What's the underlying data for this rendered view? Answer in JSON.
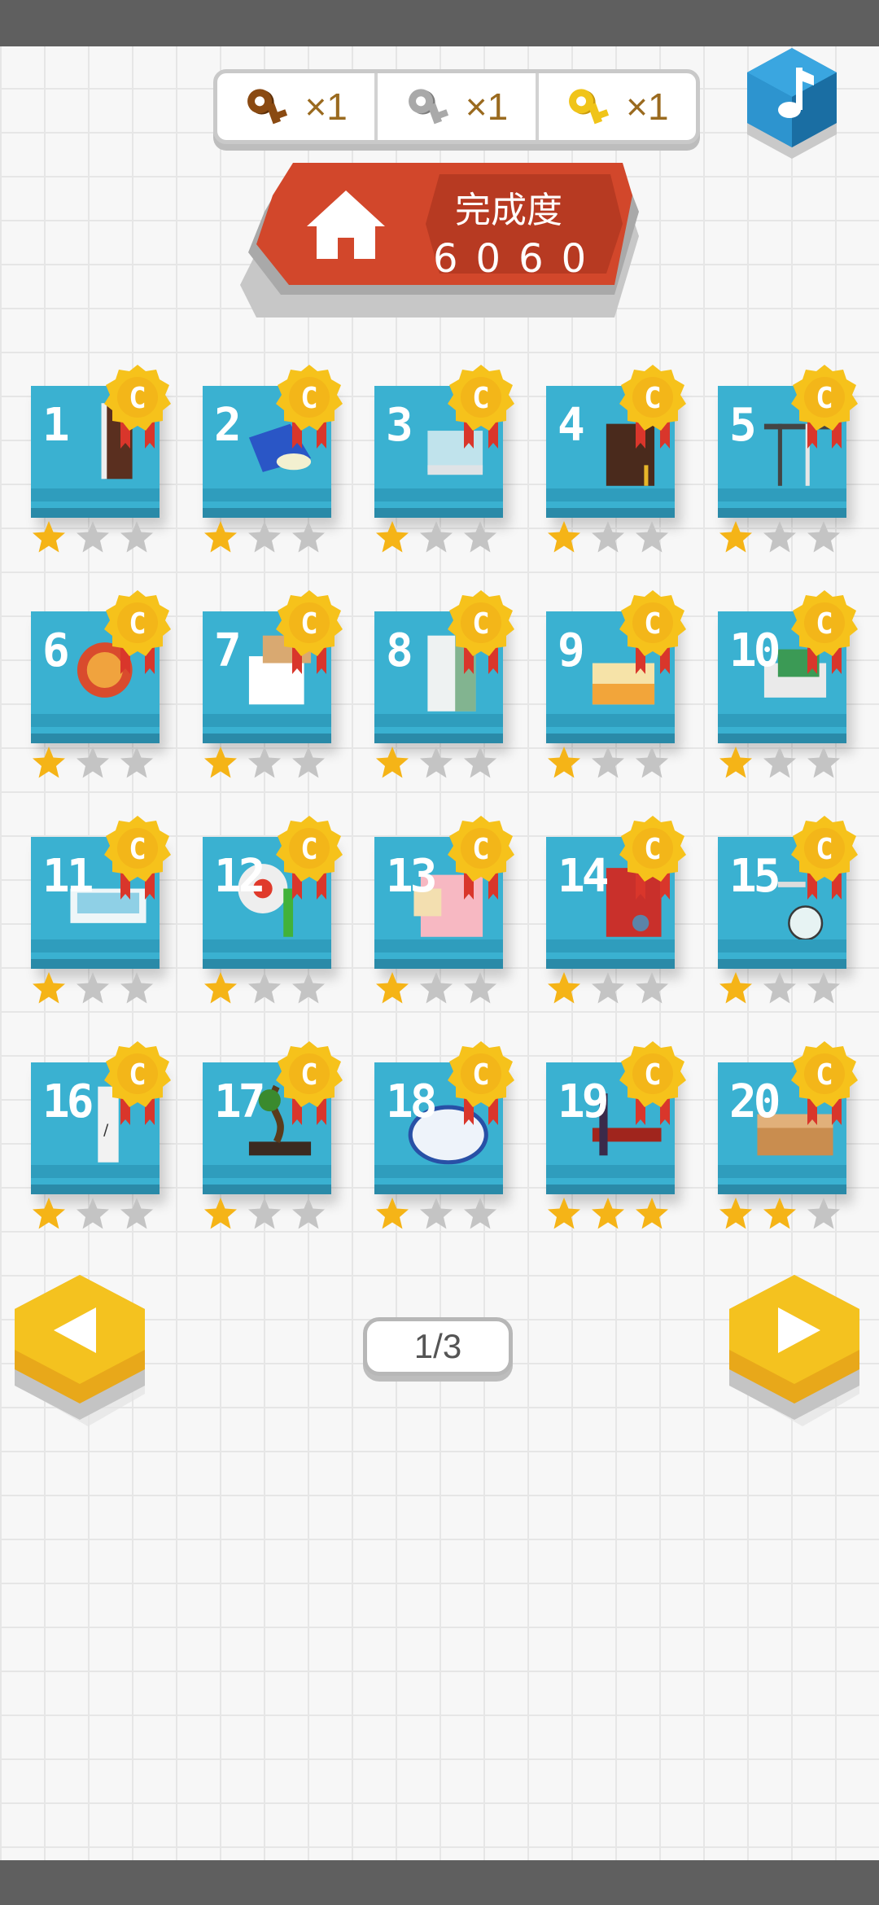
{
  "keys": [
    {
      "name": "bronze-key",
      "count": "×1",
      "color": "#8a4a12",
      "shade": "#5c2f08"
    },
    {
      "name": "silver-key",
      "count": "×1",
      "color": "#a9a9a9",
      "shade": "#7d7d7d"
    },
    {
      "name": "gold-key",
      "count": "×1",
      "color": "#f0c419",
      "shade": "#c99a0e"
    }
  ],
  "music_icon": "music-note-icon",
  "banner": {
    "title": "完成度",
    "value": "6060",
    "color": "#d2472b",
    "home_icon": "home-icon"
  },
  "levels": [
    {
      "number": "1",
      "stars": 1
    },
    {
      "number": "2",
      "stars": 1
    },
    {
      "number": "3",
      "stars": 1
    },
    {
      "number": "4",
      "stars": 1
    },
    {
      "number": "5",
      "stars": 1
    },
    {
      "number": "6",
      "stars": 1
    },
    {
      "number": "7",
      "stars": 1
    },
    {
      "number": "8",
      "stars": 1
    },
    {
      "number": "9",
      "stars": 1
    },
    {
      "number": "10",
      "stars": 1
    },
    {
      "number": "11",
      "stars": 1
    },
    {
      "number": "12",
      "stars": 1
    },
    {
      "number": "13",
      "stars": 1
    },
    {
      "number": "14",
      "stars": 1
    },
    {
      "number": "15",
      "stars": 1
    },
    {
      "number": "16",
      "stars": 1
    },
    {
      "number": "17",
      "stars": 1
    },
    {
      "number": "18",
      "stars": 1
    },
    {
      "number": "19",
      "stars": 3
    },
    {
      "number": "20",
      "stars": 2
    }
  ],
  "medal_label": "C",
  "pagination": {
    "page": "1/3",
    "prev_icon": "arrow-left-icon",
    "next_icon": "arrow-right-icon"
  },
  "colors": {
    "tile": "#3ab1d1",
    "star_on": "#f5b417",
    "star_off": "#c4c4c4",
    "medal": "#f6c21b",
    "ribbon": "#d9362b",
    "nav": "#f4c21f"
  }
}
